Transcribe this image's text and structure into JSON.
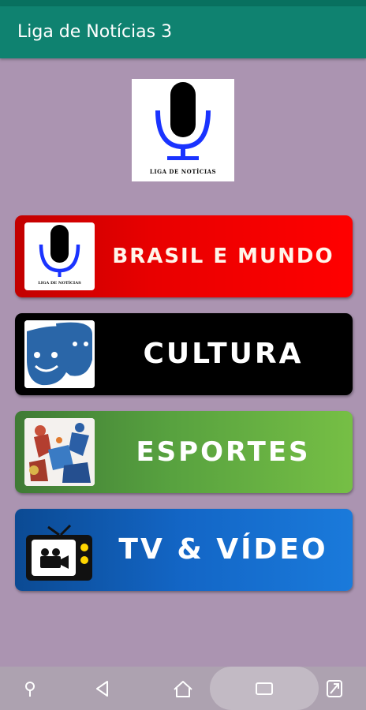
{
  "app": {
    "title": "Liga de Notícias 3"
  },
  "logo": {
    "caption": "LIGA DE NOTÍCIAS"
  },
  "menu": [
    {
      "label": "BRASIL E MUNDO",
      "icon": "microphone-icon",
      "icon_caption": "LIGA DE NOTÍCIAS"
    },
    {
      "label": "CULTURA",
      "icon": "theater-masks-icon"
    },
    {
      "label": "ESPORTES",
      "icon": "sports-collage-icon"
    },
    {
      "label": "TV & VÍDEO",
      "icon": "tv-video-camera-icon"
    }
  ],
  "navbar": {
    "items": [
      "pin-icon",
      "back-icon",
      "home-icon",
      "recents-icon",
      "expand-icon"
    ]
  },
  "colors": {
    "appbar": "#0f8270",
    "background": "#ab94b1",
    "brasil": "#ff0000",
    "cultura": "#000000",
    "esportes": "#57a13f",
    "tv": "#1366c6"
  }
}
